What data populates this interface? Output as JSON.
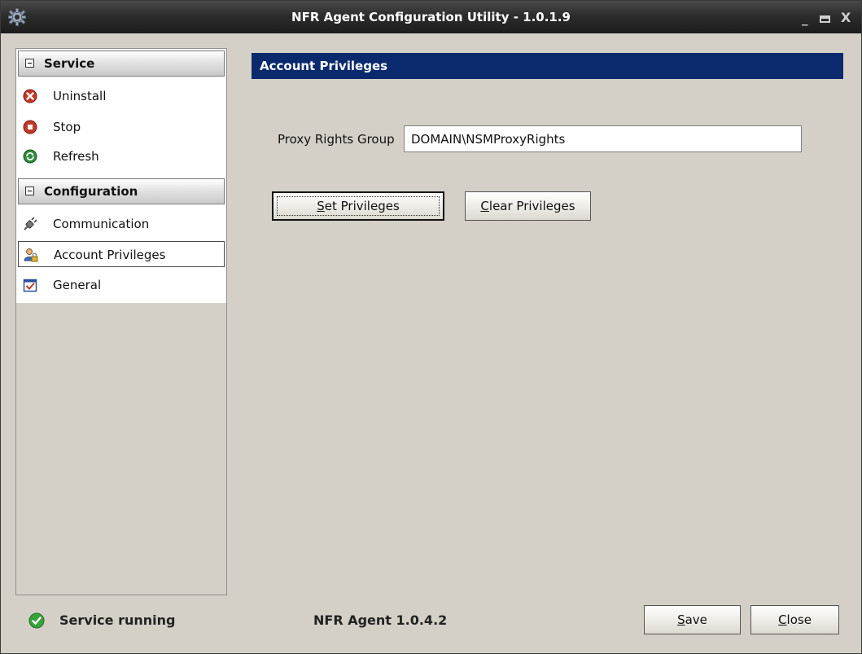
{
  "window": {
    "title": "NFR Agent Configuration Utility - 1.0.1.9",
    "minimize_glyph": "_",
    "close_glyph": "X"
  },
  "sidebar": {
    "groups": [
      {
        "label": "Service",
        "items": [
          {
            "label": "Uninstall",
            "icon": "uninstall-icon"
          },
          {
            "label": "Stop",
            "icon": "stop-icon"
          },
          {
            "label": "Refresh",
            "icon": "refresh-icon"
          }
        ]
      },
      {
        "label": "Configuration",
        "items": [
          {
            "label": "Communication",
            "icon": "plug-icon"
          },
          {
            "label": "Account Privileges",
            "icon": "user-lock-icon",
            "selected": true
          },
          {
            "label": "General",
            "icon": "checklist-icon"
          }
        ]
      }
    ]
  },
  "content": {
    "header": "Account Privileges",
    "proxy_label": "Proxy Rights Group",
    "proxy_value": "DOMAIN\\NSMProxyRights",
    "set_button": {
      "accel": "S",
      "rest": "et Privileges"
    },
    "clear_button": {
      "accel": "C",
      "rest": "lear Privileges"
    }
  },
  "footer": {
    "status": "Service running",
    "version": "NFR Agent 1.0.4.2",
    "save_button": {
      "accel": "S",
      "rest": "ave"
    },
    "close_button": {
      "accel": "C",
      "rest": "lose"
    }
  },
  "colors": {
    "header_bg": "#0b2a6e",
    "titlebar_bg": "#2d2d2d",
    "window_bg": "#d4d0c8",
    "status_ok": "#3aa23a"
  }
}
